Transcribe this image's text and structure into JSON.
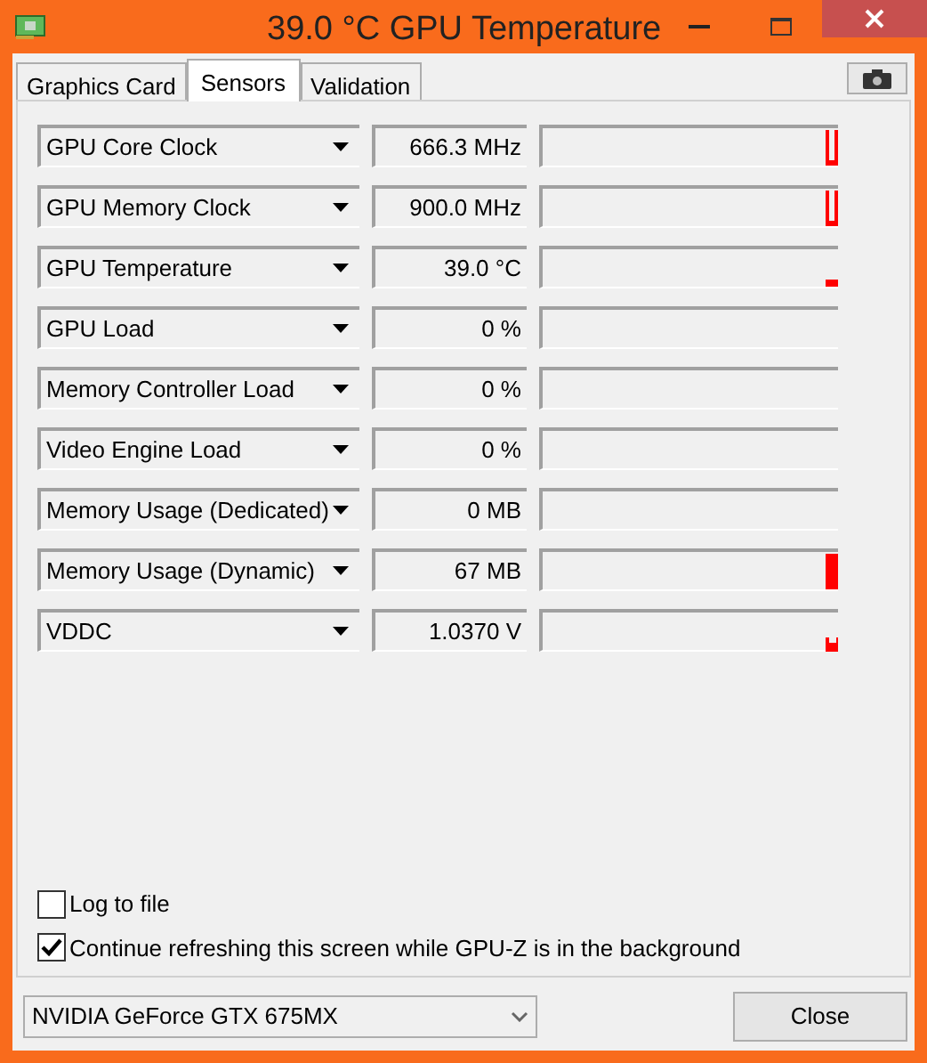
{
  "window": {
    "title": "39.0 °C GPU Temperature"
  },
  "tabs": [
    {
      "label": "Graphics Card",
      "selected": false
    },
    {
      "label": "Sensors",
      "selected": true
    },
    {
      "label": "Validation",
      "selected": false
    }
  ],
  "sensors": [
    {
      "name": "GPU Core Clock",
      "value": "666.3 MHz",
      "kind": "spike"
    },
    {
      "name": "GPU Memory Clock",
      "value": "900.0 MHz",
      "kind": "spike"
    },
    {
      "name": "GPU Temperature",
      "value": "39.0 °C",
      "kind": "low"
    },
    {
      "name": "GPU Load",
      "value": "0 %",
      "kind": "flat"
    },
    {
      "name": "Memory Controller Load",
      "value": "0 %",
      "kind": "flat"
    },
    {
      "name": "Video Engine Load",
      "value": "0 %",
      "kind": "flat"
    },
    {
      "name": "Memory Usage (Dedicated)",
      "value": "0 MB",
      "kind": "flat"
    },
    {
      "name": "Memory Usage (Dynamic)",
      "value": "67 MB",
      "kind": "block"
    },
    {
      "name": "VDDC",
      "value": "1.0370 V",
      "kind": "notch"
    }
  ],
  "options": [
    {
      "label": "Log to file",
      "checked": false
    },
    {
      "label": "Continue refreshing this screen while GPU-Z is in the background",
      "checked": true
    }
  ],
  "device_select": {
    "value": "NVIDIA GeForce GTX 675MX"
  },
  "close_button": "Close"
}
